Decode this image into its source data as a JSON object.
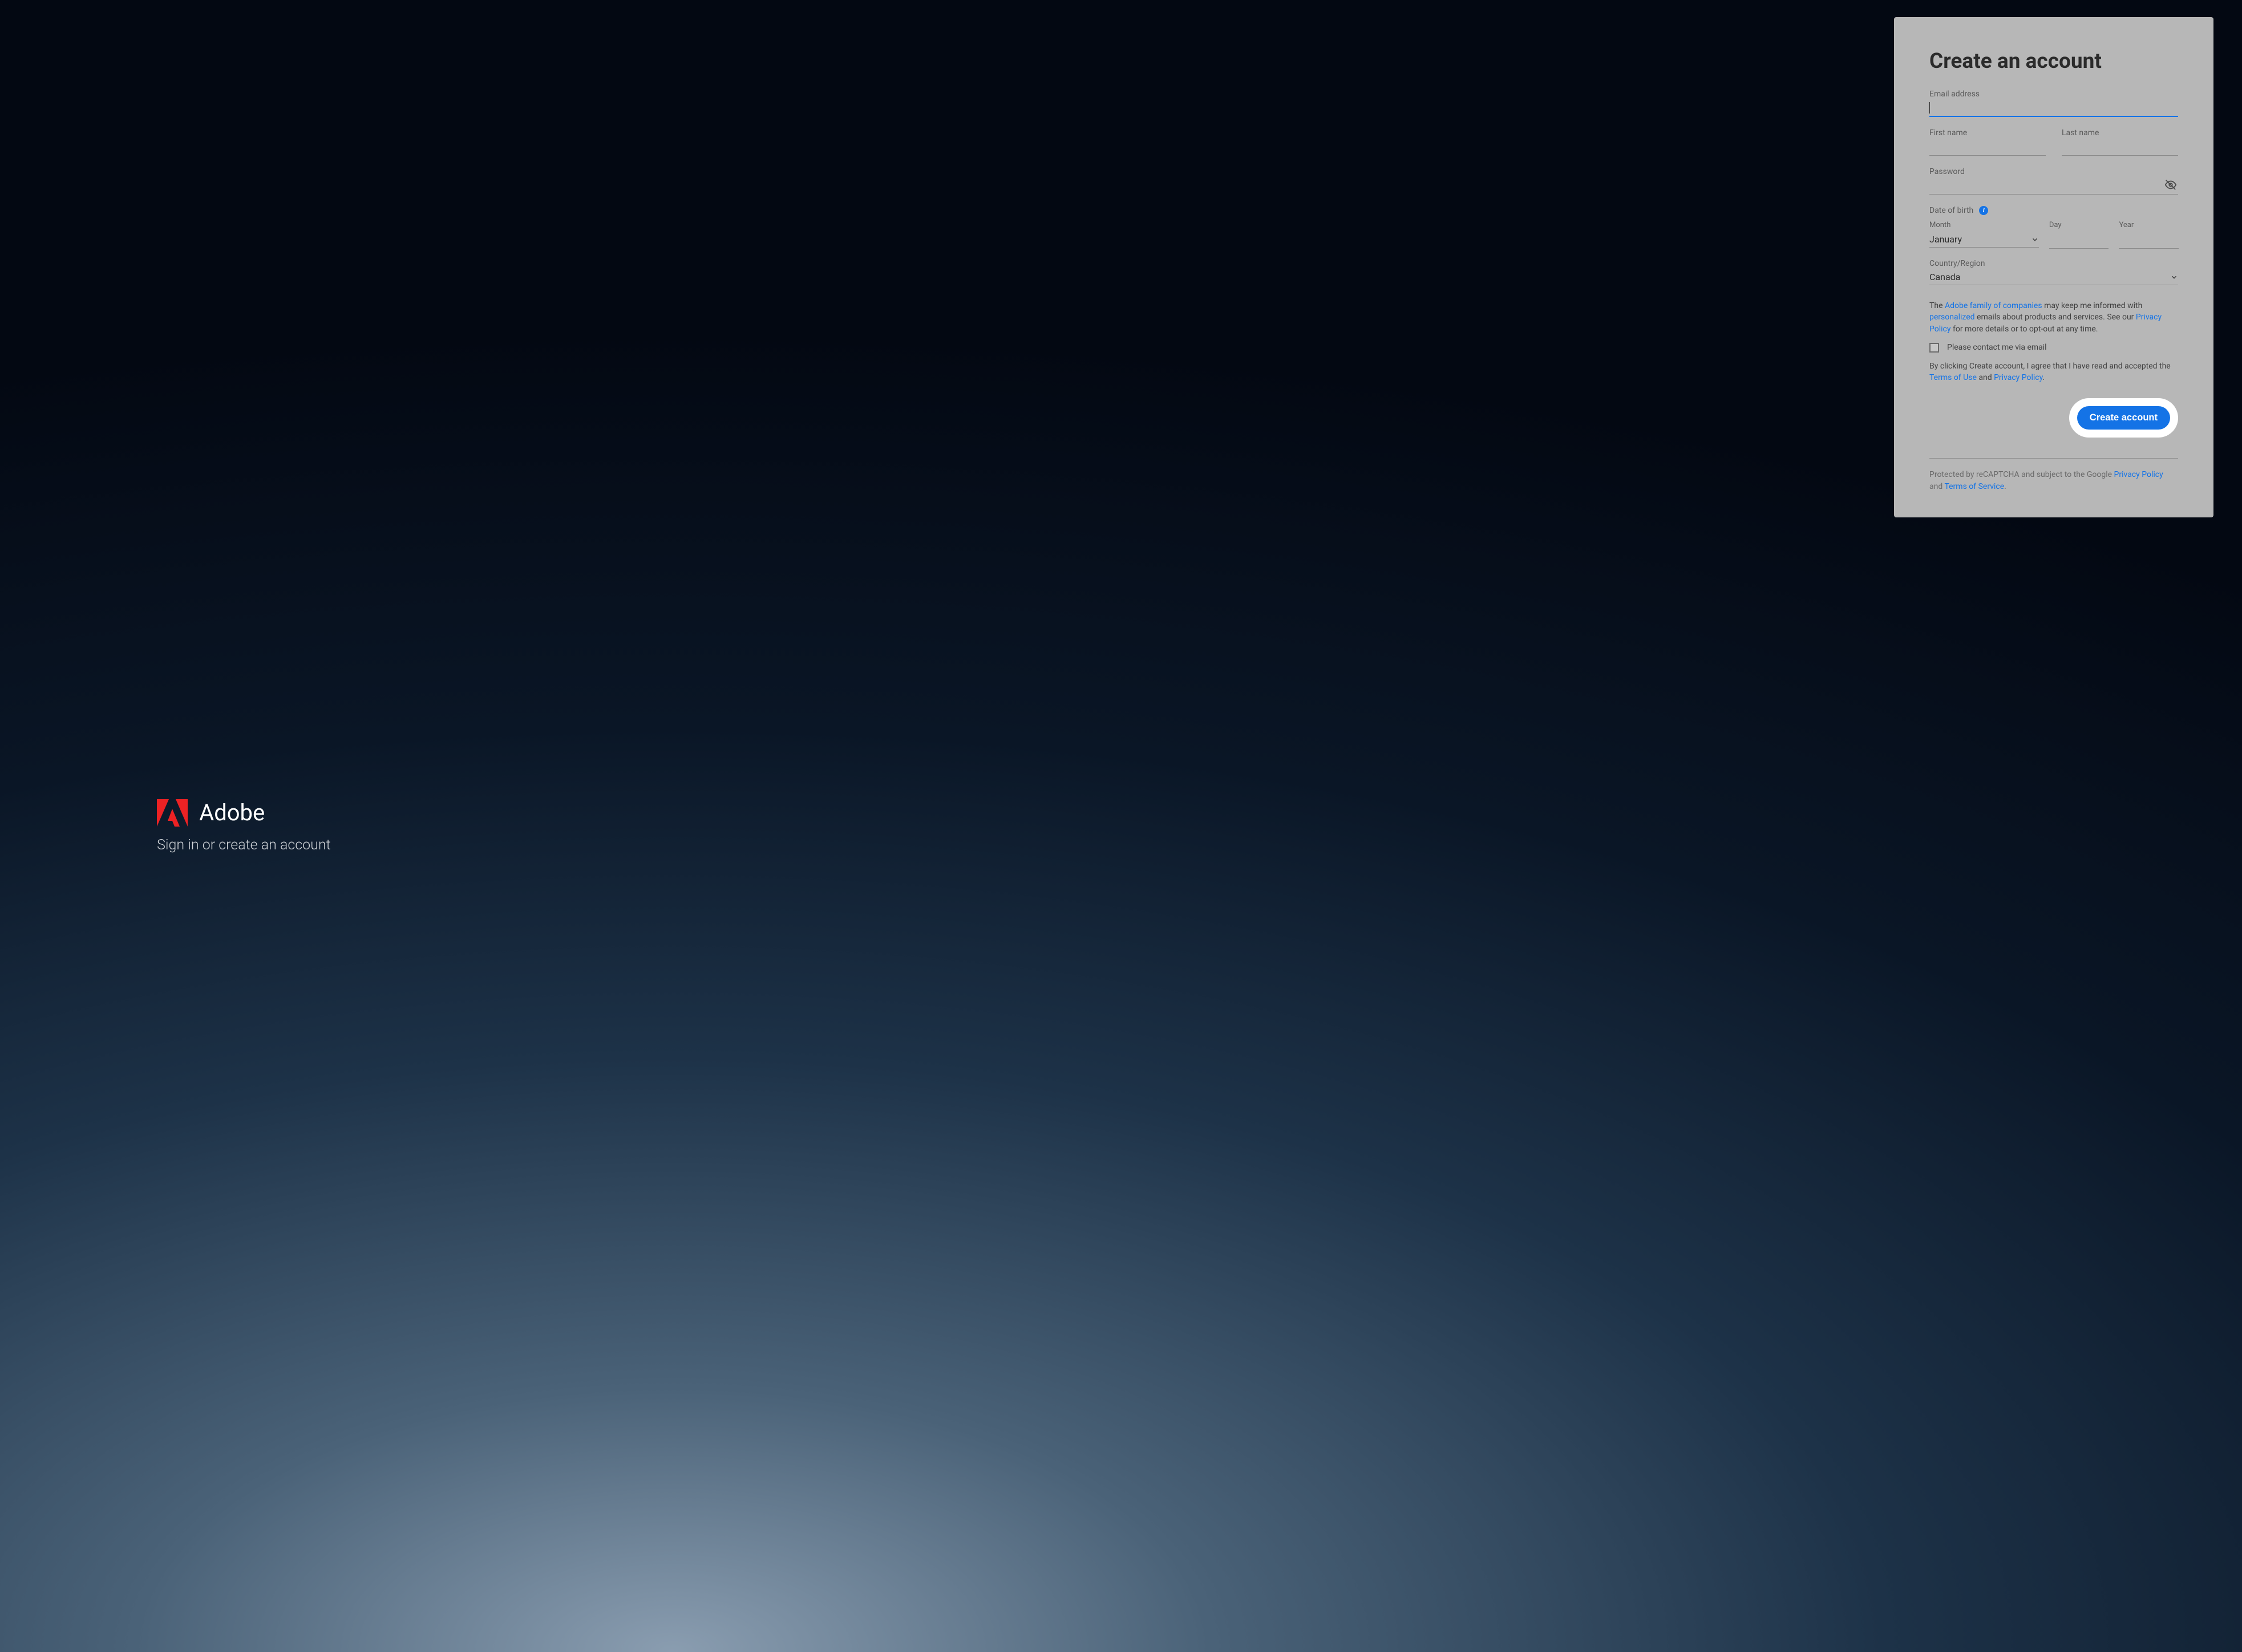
{
  "brand": {
    "name": "Adobe",
    "tagline": "Sign in or create an account"
  },
  "form": {
    "title": "Create an account",
    "email_label": "Email address",
    "email_value": "",
    "first_name_label": "First name",
    "first_name_value": "",
    "last_name_label": "Last name",
    "last_name_value": "",
    "password_label": "Password",
    "password_value": "",
    "dob_label": "Date of birth",
    "month_label": "Month",
    "month_value": "January",
    "day_label": "Day",
    "day_value": "",
    "year_label": "Year",
    "year_value": "",
    "country_label": "Country/Region",
    "country_value": "Canada",
    "info_glyph": "i",
    "contact_checkbox_label": "Please contact me via email",
    "legal1_prefix": "The ",
    "legal1_link1": "Adobe family of companies",
    "legal1_mid1": " may keep me informed with ",
    "legal1_link2": "personalized",
    "legal1_mid2": " emails about products and services. See our ",
    "legal1_link3": "Privacy Policy",
    "legal1_suffix": " for more details or to opt-out at any time.",
    "legal2_prefix": "By clicking Create account, I agree that I have read and accepted the ",
    "legal2_link1": "Terms of Use",
    "legal2_mid": " and ",
    "legal2_link2": "Privacy Policy",
    "legal2_suffix": ".",
    "submit_label": "Create account",
    "recaptcha_prefix": "Protected by reCAPTCHA and subject to the Google ",
    "recaptcha_link1": "Privacy Policy",
    "recaptcha_mid": " and ",
    "recaptcha_link2": "Terms of Service",
    "recaptcha_suffix": "."
  }
}
